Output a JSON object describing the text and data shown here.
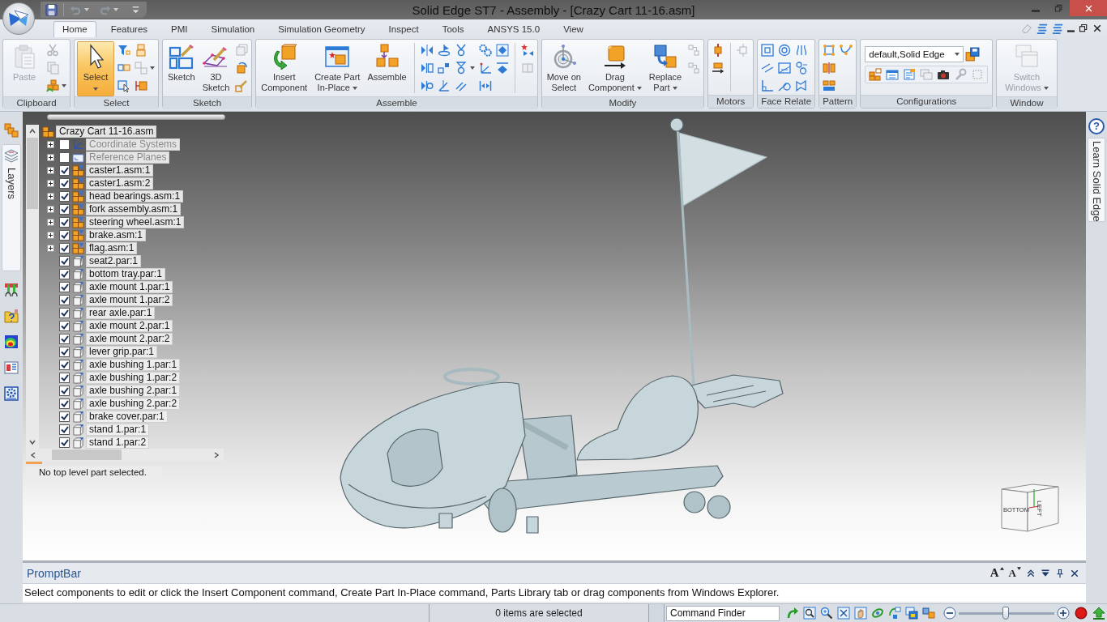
{
  "window": {
    "title": "Solid Edge ST7 - Assembly - [Crazy Cart 11-16.asm]"
  },
  "tabs": [
    {
      "label": "Home",
      "selected": true
    },
    {
      "label": "Features",
      "selected": false
    },
    {
      "label": "PMI",
      "selected": false
    },
    {
      "label": "Simulation",
      "selected": false
    },
    {
      "label": "Simulation Geometry",
      "selected": false
    },
    {
      "label": "Inspect",
      "selected": false
    },
    {
      "label": "Tools",
      "selected": false
    },
    {
      "label": "ANSYS 15.0",
      "selected": false
    },
    {
      "label": "View",
      "selected": false
    }
  ],
  "ribbon": {
    "groups": [
      {
        "label": "Clipboard",
        "buttons": [
          {
            "kind": "paste",
            "label": "Paste",
            "selected": false,
            "disabled": true,
            "dropdown": false
          }
        ]
      },
      {
        "label": "Select",
        "buttons": [
          {
            "kind": "pointer",
            "label": "Select",
            "selected": true,
            "disabled": false,
            "dropdown": true
          }
        ]
      },
      {
        "label": "Sketch",
        "buttons": [
          {
            "kind": "sketch",
            "label": "Sketch",
            "selected": false,
            "disabled": false,
            "dropdown": false
          },
          {
            "kind": "sketch3d",
            "label": "3D\nSketch",
            "selected": false,
            "disabled": false,
            "dropdown": false
          }
        ]
      },
      {
        "label": "Assemble",
        "buttons": [
          {
            "kind": "insert",
            "label": "Insert\nComponent",
            "selected": false,
            "disabled": false,
            "dropdown": false
          },
          {
            "kind": "inplace",
            "label": "Create Part\nIn-Place",
            "selected": false,
            "disabled": false,
            "dropdown": true
          },
          {
            "kind": "assemble",
            "label": "Assemble",
            "selected": false,
            "disabled": false,
            "dropdown": false
          }
        ]
      },
      {
        "label": "Modify",
        "buttons": [
          {
            "kind": "move",
            "label": "Move on\nSelect",
            "selected": false,
            "disabled": false,
            "dropdown": false
          },
          {
            "kind": "drag",
            "label": "Drag\nComponent",
            "selected": false,
            "disabled": false,
            "dropdown": true
          },
          {
            "kind": "replace",
            "label": "Replace\nPart",
            "selected": false,
            "disabled": false,
            "dropdown": true
          }
        ]
      },
      {
        "label": "Motors"
      },
      {
        "label": "Face Relate"
      },
      {
        "label": "Pattern"
      },
      {
        "label": "Configurations",
        "combo": {
          "value": "default,Solid Edge"
        }
      },
      {
        "label": "Window",
        "buttons": [
          {
            "kind": "windows",
            "label": "Switch\nWindows",
            "selected": false,
            "disabled": true,
            "dropdown": true
          }
        ]
      }
    ]
  },
  "side_panels": {
    "left_tabs": [
      {
        "label": "Layers"
      }
    ],
    "help_glyph": "?",
    "right_tabs": [
      {
        "label": "Learn Solid Edge"
      }
    ]
  },
  "tree": {
    "root": {
      "kind": "assembly",
      "label": "Crazy Cart 11-16.asm",
      "children": [
        {
          "kind": "coordinates",
          "label": "Coordinate Systems",
          "checked": false,
          "collapsed": true
        },
        {
          "kind": "planes",
          "label": "Reference Planes",
          "checked": false,
          "collapsed": true
        },
        {
          "kind": "assembly",
          "label": "caster1.asm:1",
          "checked": true,
          "collapsed": true
        },
        {
          "kind": "assembly",
          "label": "caster1.asm:2",
          "checked": true,
          "collapsed": true
        },
        {
          "kind": "assembly",
          "label": "head bearings.asm:1",
          "checked": true,
          "collapsed": true
        },
        {
          "kind": "assembly",
          "label": "fork assembly.asm:1",
          "checked": true,
          "collapsed": true
        },
        {
          "kind": "assembly",
          "label": "steering wheel.asm:1",
          "checked": true,
          "collapsed": true
        },
        {
          "kind": "assembly",
          "label": "brake.asm:1",
          "checked": true,
          "collapsed": true
        },
        {
          "kind": "assembly",
          "label": "flag.asm:1",
          "checked": true,
          "collapsed": true
        },
        {
          "kind": "part",
          "label": "seat2.par:1",
          "checked": true,
          "collapsed": false
        },
        {
          "kind": "part",
          "label": "bottom tray.par:1",
          "checked": true,
          "collapsed": false
        },
        {
          "kind": "part",
          "label": "axle mount 1.par:1",
          "checked": true,
          "collapsed": false
        },
        {
          "kind": "part",
          "label": "axle mount 1.par:2",
          "checked": true,
          "collapsed": false
        },
        {
          "kind": "part",
          "label": "rear axle.par:1",
          "checked": true,
          "collapsed": false
        },
        {
          "kind": "part",
          "label": "axle mount 2.par:1",
          "checked": true,
          "collapsed": false
        },
        {
          "kind": "part",
          "label": "axle mount 2.par:2",
          "checked": true,
          "collapsed": false
        },
        {
          "kind": "part",
          "label": "lever grip.par:1",
          "checked": true,
          "collapsed": false
        },
        {
          "kind": "part",
          "label": "axle bushing 1.par:1",
          "checked": true,
          "collapsed": false
        },
        {
          "kind": "part",
          "label": "axle bushing 1.par:2",
          "checked": true,
          "collapsed": false
        },
        {
          "kind": "part",
          "label": "axle bushing 2.par:1",
          "checked": true,
          "collapsed": false
        },
        {
          "kind": "part",
          "label": "axle bushing 2.par:2",
          "checked": true,
          "collapsed": false
        },
        {
          "kind": "part",
          "label": "brake cover.par:1",
          "checked": true,
          "collapsed": false
        },
        {
          "kind": "part",
          "label": "stand 1.par:1",
          "checked": true,
          "collapsed": false
        },
        {
          "kind": "part",
          "label": "stand 1.par:2",
          "checked": true,
          "collapsed": false
        }
      ]
    },
    "status": "No top level part selected."
  },
  "viewport": {
    "view_cube": {
      "faces": [
        {
          "kind": "front",
          "label": "BOTTOM"
        },
        {
          "kind": "side",
          "label": "LEFT"
        }
      ]
    }
  },
  "prompt_bar": {
    "title": "PromptBar",
    "tools": [
      {
        "kind": "grow",
        "glyph": "A"
      },
      {
        "kind": "shrink",
        "glyph": "A"
      }
    ],
    "message": "Select components to edit or click the Insert Component command, Create Part In-Place command, Parts Library tab or drag components from Windows Explorer."
  },
  "status_bar": {
    "selection": "0 items are selected",
    "command_finder": {
      "placeholder": "Command Finder"
    },
    "zoom": {
      "level": 0.49
    }
  }
}
